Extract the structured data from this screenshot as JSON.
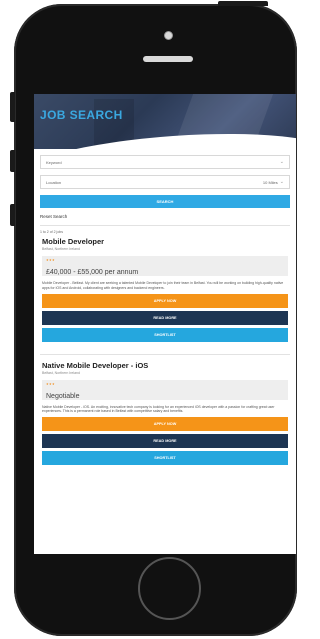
{
  "page": {
    "hero_title": "JOB SEARCH"
  },
  "form": {
    "keyword_placeholder": "Keyword",
    "location_placeholder": "Location",
    "radius_value": "10 Miles",
    "search_label": "SEARCH",
    "reset_label": "Reset Search"
  },
  "results": {
    "count_text": "1 to 2 of 2 jobs"
  },
  "jobs": [
    {
      "title": "Mobile Developer",
      "location": "Belfast, Northern Ireland",
      "rating": "★★★",
      "salary": "£40,000 - £55,000 per annum",
      "description": "Mobile Developer - Belfast. My client are seeking a talented Mobile Developer to join their team in Belfast. You will be working on building high-quality native apps for iOS and Android, collaborating with designers and backend engineers.",
      "apply_label": "APPLY NOW",
      "read_label": "READ MORE",
      "shortlist_label": "SHORTLIST"
    },
    {
      "title": "Native Mobile Developer - iOS",
      "location": "Belfast, Northern Ireland",
      "rating": "★★★",
      "salary": "Negotiable",
      "description": "Native Mobile Developer - iOS. An exciting, innovative tech company is looking for an experienced iOS developer with a passion for crafting great user experiences. This is a permanent role based in Belfast with competitive salary and benefits.",
      "apply_label": "APPLY NOW",
      "read_label": "READ MORE",
      "shortlist_label": "SHORTLIST"
    }
  ],
  "colors": {
    "accent_blue": "#2fa9e4",
    "apply_orange": "#f59418",
    "read_navy": "#1d3553"
  },
  "icons": {
    "keyword_select": "chevron-down-icon",
    "radius_select": "chevron-down-icon"
  }
}
